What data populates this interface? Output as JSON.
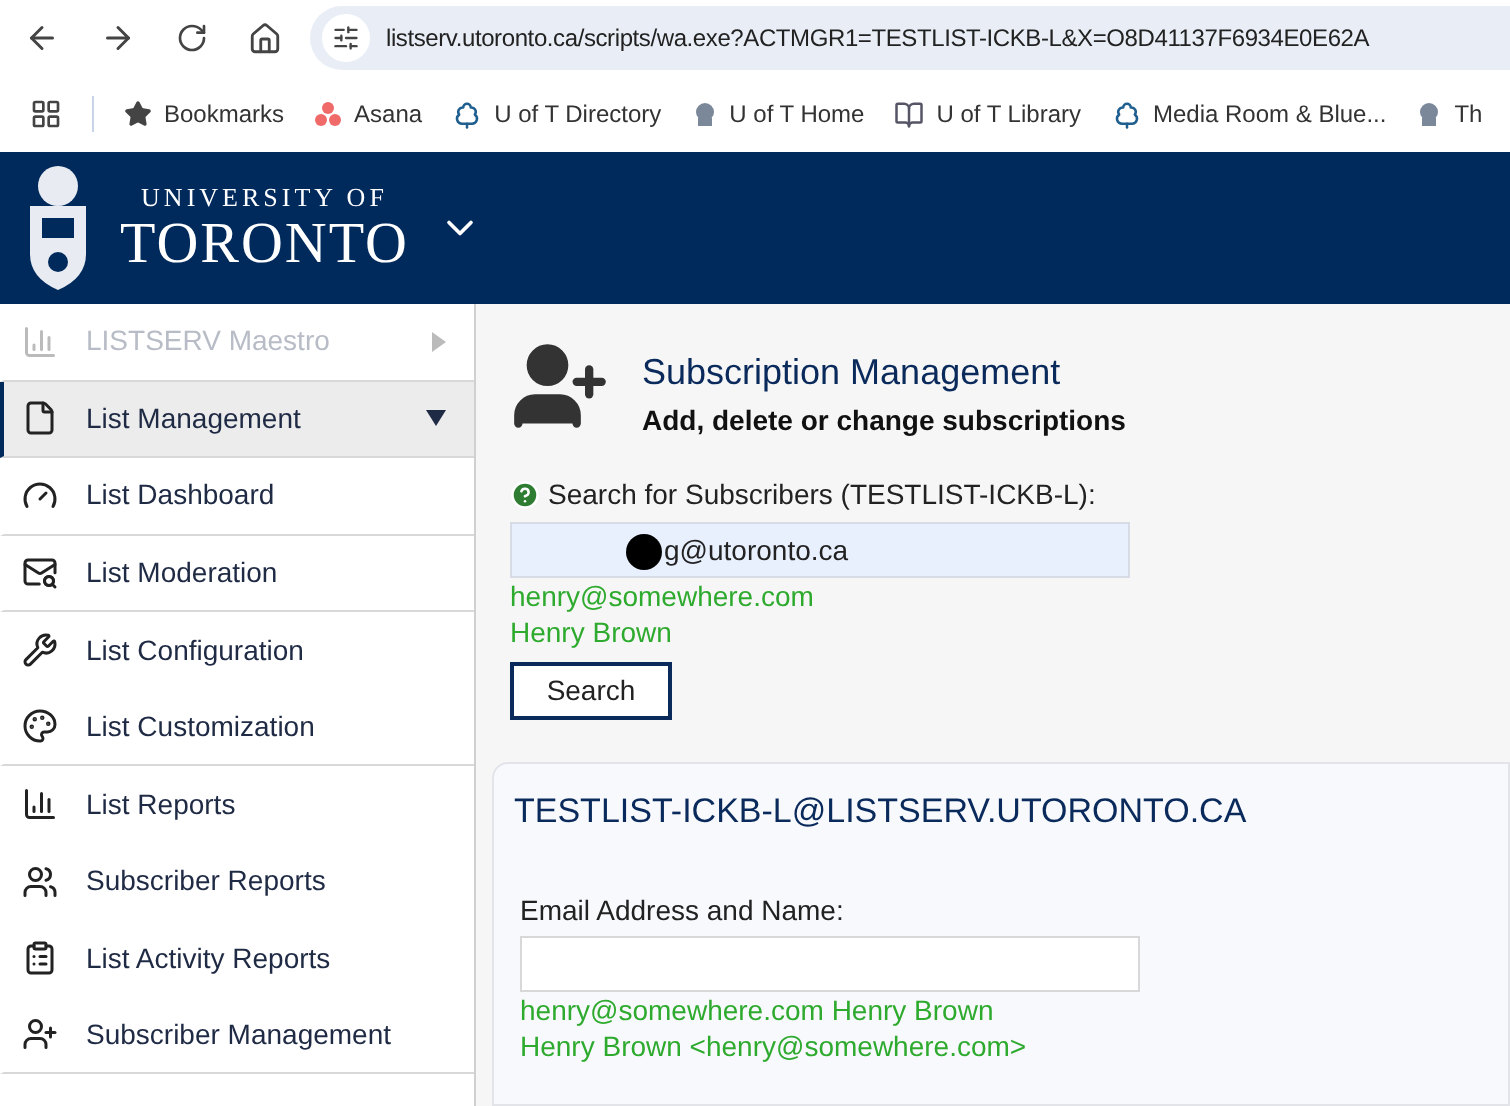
{
  "browser": {
    "url": "listserv.utoronto.ca/scripts/wa.exe?ACTMGR1=TESTLIST-ICKB-L&X=O8D41137F6934E0E62A",
    "bookmarks": [
      {
        "label": "Bookmarks",
        "kind": "star"
      },
      {
        "label": "Asana",
        "kind": "dots"
      },
      {
        "label": "U of T Directory",
        "kind": "tree"
      },
      {
        "label": "U of T Home",
        "kind": "crest"
      },
      {
        "label": "U of T Library",
        "kind": "book"
      },
      {
        "label": "Media Room & Blue...",
        "kind": "tree"
      },
      {
        "label": "Th",
        "kind": "crest"
      }
    ]
  },
  "header": {
    "logo_line_1": "UNIVERSITY OF",
    "logo_line_2": "TORONTO"
  },
  "sidebar": {
    "items": [
      {
        "label": "LISTSERV Maestro",
        "disabled": true,
        "selected": false,
        "expanded": false,
        "divider": true
      },
      {
        "label": "List Management",
        "disabled": false,
        "selected": true,
        "expanded": true,
        "divider": true
      },
      {
        "label": "List Dashboard",
        "disabled": false,
        "selected": false,
        "divider": true
      },
      {
        "label": "List Moderation",
        "disabled": false,
        "selected": false,
        "divider": true
      },
      {
        "label": "List Configuration",
        "disabled": false,
        "selected": false,
        "divider": false
      },
      {
        "label": "List Customization",
        "disabled": false,
        "selected": false,
        "divider": true
      },
      {
        "label": "List Reports",
        "disabled": false,
        "selected": false,
        "divider": false
      },
      {
        "label": "Subscriber Reports",
        "disabled": false,
        "selected": false,
        "divider": false
      },
      {
        "label": "List Activity Reports",
        "disabled": false,
        "selected": false,
        "divider": false
      },
      {
        "label": "Subscriber Management",
        "disabled": false,
        "selected": false,
        "divider": true
      }
    ]
  },
  "page": {
    "title": "Subscription Management",
    "subtitle": "Add, delete or change subscriptions",
    "search": {
      "label": "Search for Subscribers (TESTLIST-ICKB-L):",
      "value": "g@utoronto.ca",
      "hints": [
        "henry@somewhere.com",
        "Henry Brown"
      ],
      "button": "Search"
    },
    "list_panel": {
      "title": "TESTLIST-ICKB-L@LISTSERV.UTORONTO.CA",
      "field_label": "Email Address and Name:",
      "hints": [
        "henry@somewhere.com Henry Brown",
        "Henry Brown <henry@somewhere.com>"
      ]
    }
  }
}
